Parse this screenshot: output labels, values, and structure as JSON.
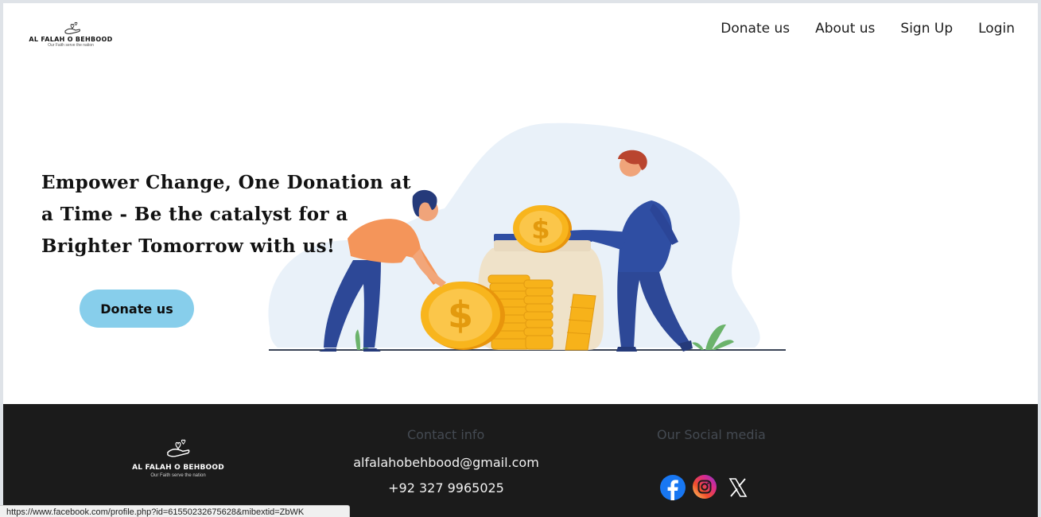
{
  "header": {
    "logo": {
      "title": "AL FALAH O BEHBOOD",
      "tagline": "Our Faith serve the nation"
    },
    "nav": [
      {
        "label": "Donate us"
      },
      {
        "label": "About us"
      },
      {
        "label": "Sign Up"
      },
      {
        "label": "Login"
      }
    ]
  },
  "hero": {
    "headline_lines": [
      "Empower Change, One Donation at",
      "a Time - Be the catalyst for a",
      "Brighter Tomorrow with us!"
    ],
    "button_label": "Donate us",
    "illustration": "donation-jar-coins-illustration"
  },
  "footer": {
    "logo": {
      "title": "AL FALAH O BEHBOOD",
      "tagline": "Our Faith serve the nation"
    },
    "contact": {
      "heading": "Contact info",
      "email": "alfalahobehbood@gmail.com",
      "phone": "+92 327 9965025"
    },
    "social": {
      "heading": "Our Social media",
      "icons": [
        "facebook-icon",
        "instagram-icon",
        "x-icon"
      ]
    }
  },
  "status_bar": {
    "url": "https://www.facebook.com/profile.php?id=61550232675628&mibextid=ZbWK"
  },
  "colors": {
    "accent": "#87ceeb",
    "footer_bg": "#1b1b1b",
    "muted": "#444a52"
  }
}
